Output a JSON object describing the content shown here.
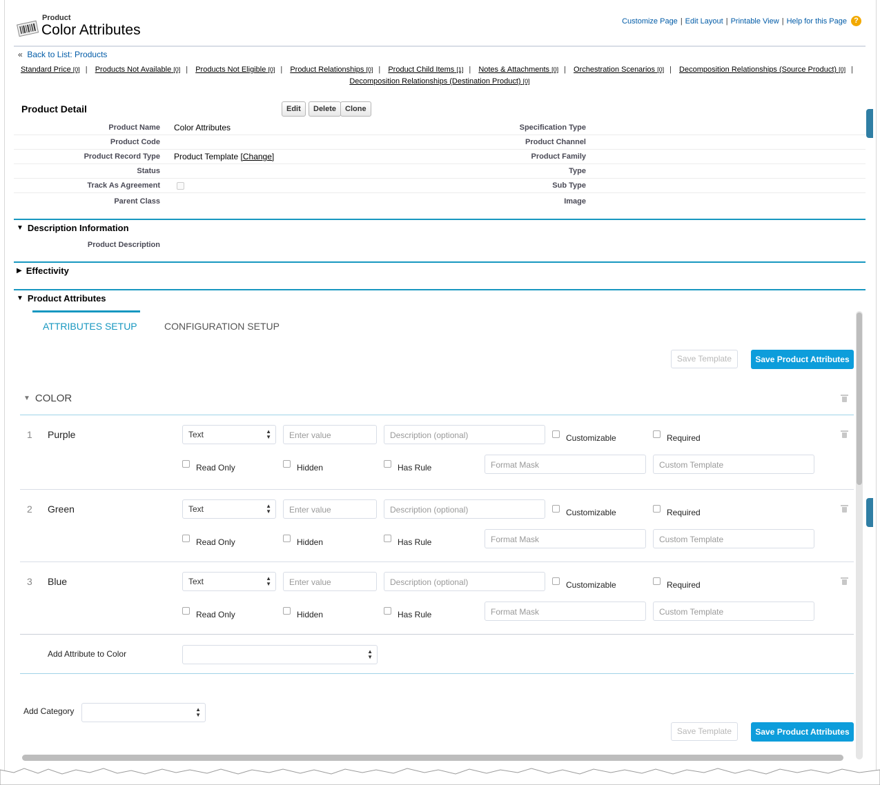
{
  "header": {
    "object_type": "Product",
    "title": "Color Attributes",
    "links": [
      "Customize Page",
      "Edit Layout",
      "Printable View",
      "Help for this Page"
    ],
    "help_icon_glyph": "?"
  },
  "back_link": {
    "prefix": "«",
    "label": "Back to List: Products"
  },
  "related_lists": [
    {
      "label": "Standard Price",
      "count": "[0]"
    },
    {
      "label": "Products Not Available",
      "count": "[0]"
    },
    {
      "label": "Products Not Eligible",
      "count": "[0]"
    },
    {
      "label": "Product Relationships",
      "count": "[0]"
    },
    {
      "label": "Product Child Items",
      "count": "[1]"
    },
    {
      "label": "Notes & Attachments",
      "count": "[0]"
    },
    {
      "label": "Orchestration Scenarios",
      "count": "[0]"
    },
    {
      "label": "Decomposition Relationships (Source Product)",
      "count": "[0]"
    },
    {
      "label": "Decomposition Relationships (Destination Product)",
      "count": "[0]"
    }
  ],
  "detail": {
    "title": "Product Detail",
    "buttons": {
      "edit": "Edit",
      "delete": "Delete",
      "clone": "Clone"
    },
    "left_fields": [
      {
        "label": "Product Name",
        "value": "Color Attributes"
      },
      {
        "label": "Product Code",
        "value": ""
      },
      {
        "label": "Product Record Type",
        "value": "Product Template",
        "link": "[Change]"
      },
      {
        "label": "Status",
        "value": ""
      },
      {
        "label": "Track As Agreement",
        "value": ""
      },
      {
        "label": "Parent Class",
        "value": ""
      }
    ],
    "right_fields": [
      {
        "label": "Specification Type"
      },
      {
        "label": "Product Channel"
      },
      {
        "label": "Product Family"
      },
      {
        "label": "Type"
      },
      {
        "label": "Sub Type"
      },
      {
        "label": "Image"
      }
    ]
  },
  "sections": {
    "description": {
      "title": "Description Information",
      "field_label": "Product Description"
    },
    "effectivity": {
      "title": "Effectivity"
    },
    "attributes": {
      "title": "Product Attributes"
    }
  },
  "tabs": {
    "active": "ATTRIBUTES SETUP",
    "inactive": "CONFIGURATION SETUP"
  },
  "actions": {
    "save_template": "Save Template",
    "save_attributes": "Save Product Attributes"
  },
  "category": {
    "name": "COLOR",
    "attributes": [
      {
        "num": "1",
        "name": "Purple",
        "type": "Text"
      },
      {
        "num": "2",
        "name": "Green",
        "type": "Text"
      },
      {
        "num": "3",
        "name": "Blue",
        "type": "Text"
      }
    ],
    "placeholders": {
      "value": "Enter value",
      "description": "Description (optional)",
      "format_mask": "Format Mask",
      "custom_template": "Custom Template"
    },
    "checkbox_labels": {
      "customizable": "Customizable",
      "required": "Required",
      "read_only": "Read Only",
      "hidden": "Hidden",
      "has_rule": "Has Rule"
    },
    "add_attribute_label": "Add Attribute to Color"
  },
  "add_category_label": "Add Category",
  "colors": {
    "accent": "#1797c0",
    "primary_button": "#0d9ddb",
    "link": "#015ba7"
  }
}
